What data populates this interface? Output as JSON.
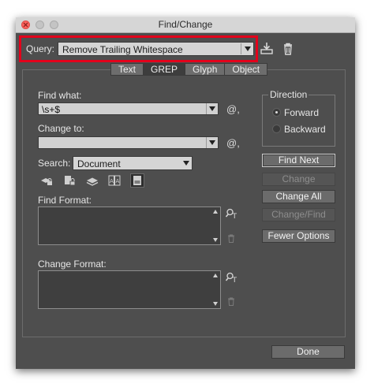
{
  "window": {
    "title": "Find/Change"
  },
  "query": {
    "label": "Query:",
    "value": "Remove Trailing Whitespace"
  },
  "tabs": [
    {
      "label": "Text",
      "active": false
    },
    {
      "label": "GREP",
      "active": true
    },
    {
      "label": "Glyph",
      "active": false
    },
    {
      "label": "Object",
      "active": false
    }
  ],
  "find_what": {
    "label": "Find what:",
    "value": "\\s+$",
    "special_char_symbol": "@,"
  },
  "change_to": {
    "label": "Change to:",
    "value": "",
    "special_char_symbol": "@,"
  },
  "search": {
    "label": "Search:",
    "value": "Document"
  },
  "direction": {
    "label": "Direction",
    "options": [
      "Forward",
      "Backward"
    ],
    "selected": "Forward"
  },
  "buttons": {
    "find_next": "Find Next",
    "change": "Change",
    "change_all": "Change All",
    "change_find": "Change/Find",
    "fewer_options": "Fewer Options",
    "done": "Done"
  },
  "find_format": {
    "label": "Find Format:"
  },
  "change_format": {
    "label": "Change Format:"
  },
  "icons": [
    "save-query-icon",
    "delete-query-icon",
    "include-locked-layers-icon",
    "include-locked-stories-icon",
    "include-hidden-layers-icon",
    "include-master-pages-icon",
    "include-footnotes-icon",
    "specify-format-icon",
    "clear-format-icon"
  ],
  "colors": {
    "highlight": "#e3001b",
    "panel": "#4e4e4e",
    "titlebar": "#d6d6d6"
  }
}
